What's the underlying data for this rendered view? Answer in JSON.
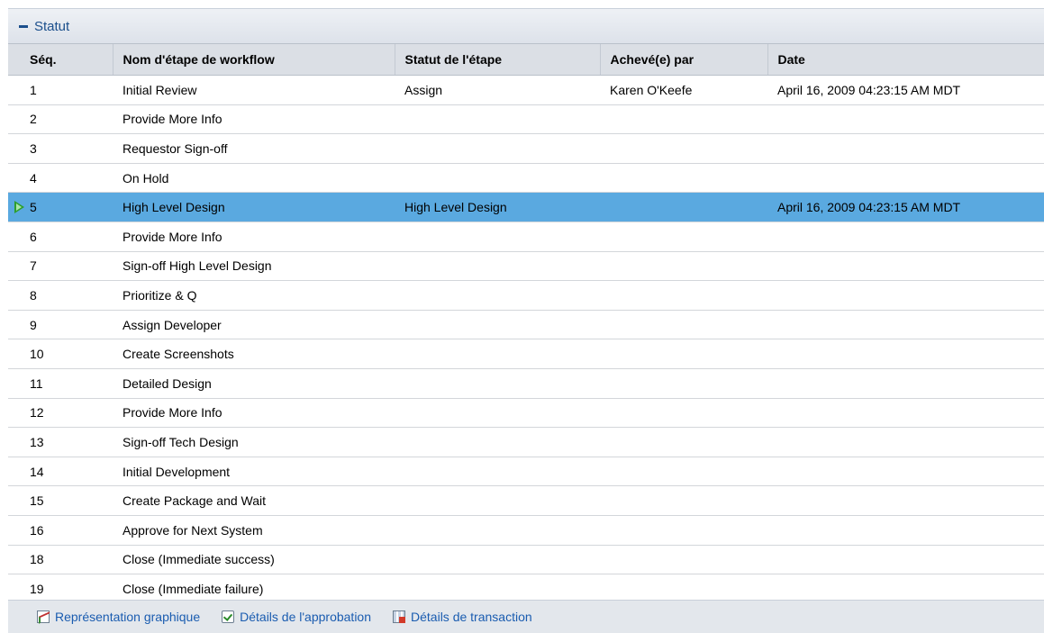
{
  "section": {
    "title": "Statut",
    "collapse_icon": "minus-icon"
  },
  "table": {
    "headers": [
      "Séq.",
      "Nom d'étape de workflow",
      "Statut de l'étape",
      "Achevé(e) par",
      "Date"
    ],
    "rows": [
      {
        "seq": "1",
        "name": "Initial Review",
        "status": "Assign",
        "by": "Karen O'Keefe",
        "date": "April 16, 2009 04:23:15 AM MDT"
      },
      {
        "seq": "2",
        "name": "Provide More Info",
        "status": "",
        "by": "",
        "date": ""
      },
      {
        "seq": "3",
        "name": "Requestor Sign-off",
        "status": "",
        "by": "",
        "date": ""
      },
      {
        "seq": "4",
        "name": "On Hold",
        "status": "",
        "by": "",
        "date": ""
      },
      {
        "seq": "5",
        "name": "High Level Design",
        "status": "High Level Design",
        "by": "",
        "date": "April 16, 2009 04:23:15 AM MDT",
        "active": true
      },
      {
        "seq": "6",
        "name": "Provide More Info",
        "status": "",
        "by": "",
        "date": ""
      },
      {
        "seq": "7",
        "name": "Sign-off High Level Design",
        "status": "",
        "by": "",
        "date": ""
      },
      {
        "seq": "8",
        "name": "Prioritize & Q",
        "status": "",
        "by": "",
        "date": ""
      },
      {
        "seq": "9",
        "name": "Assign Developer",
        "status": "",
        "by": "",
        "date": ""
      },
      {
        "seq": "10",
        "name": "Create Screenshots",
        "status": "",
        "by": "",
        "date": ""
      },
      {
        "seq": "11",
        "name": "Detailed Design",
        "status": "",
        "by": "",
        "date": ""
      },
      {
        "seq": "12",
        "name": "Provide More Info",
        "status": "",
        "by": "",
        "date": ""
      },
      {
        "seq": "13",
        "name": "Sign-off Tech Design",
        "status": "",
        "by": "",
        "date": ""
      },
      {
        "seq": "14",
        "name": "Initial Development",
        "status": "",
        "by": "",
        "date": ""
      },
      {
        "seq": "15",
        "name": "Create Package and Wait",
        "status": "",
        "by": "",
        "date": ""
      },
      {
        "seq": "16",
        "name": "Approve for Next System",
        "status": "",
        "by": "",
        "date": ""
      },
      {
        "seq": "18",
        "name": "Close (Immediate success)",
        "status": "",
        "by": "",
        "date": ""
      },
      {
        "seq": "19",
        "name": "Close (Immediate failure)",
        "status": "",
        "by": "",
        "date": ""
      }
    ],
    "active_row_color": "#5aa9e0",
    "active_icon": "play-arrow-icon"
  },
  "footer": {
    "links": [
      {
        "label": "Représentation graphique",
        "icon": "graph-icon"
      },
      {
        "label": "Détails de l'approbation",
        "icon": "checkbox-icon"
      },
      {
        "label": "Détails de transaction",
        "icon": "transaction-icon"
      }
    ]
  }
}
